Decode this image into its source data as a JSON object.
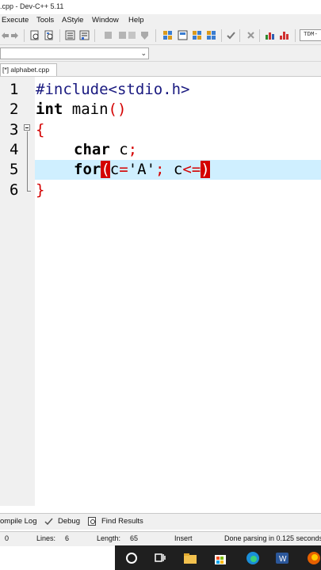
{
  "window": {
    "title": ".cpp - Dev-C++ 5.11"
  },
  "menu": [
    "Execute",
    "Tools",
    "AStyle",
    "Window",
    "Help"
  ],
  "toolbar": {
    "compiler": "TDM-"
  },
  "editor_tab": {
    "label": "[*] alphabet.cpp"
  },
  "code": {
    "line1": {
      "num": "1",
      "text": "#include<stdio.h>"
    },
    "line2": {
      "num": "2",
      "kw": "int",
      "rest": " main",
      "paren": "()"
    },
    "line3": {
      "num": "3",
      "brace": "{"
    },
    "line4": {
      "num": "4",
      "kw": "char",
      "rest": " c",
      "semi": ";"
    },
    "line5": {
      "num": "5",
      "kw": "for",
      "open": "(",
      "a": "c",
      "eq": "=",
      "str": "'A'",
      "semi": ";",
      "b": " c",
      "op": "<=",
      "close": ")"
    },
    "line6": {
      "num": "6",
      "brace": "}"
    }
  },
  "bottom_tabs": {
    "compile_log": "ompile Log",
    "debug": "Debug",
    "find_results": "Find Results"
  },
  "status": {
    "col": "0",
    "lines_label": "Lines:",
    "lines_val": "6",
    "length_label": "Length:",
    "length_val": "65",
    "mode": "Insert",
    "message": "Done parsing in 0.125 seconds"
  },
  "colors": {
    "keyword": "#000000",
    "symbol": "#d40000",
    "highlight": "#cfefff",
    "taskbar": "#1f1f1f"
  }
}
